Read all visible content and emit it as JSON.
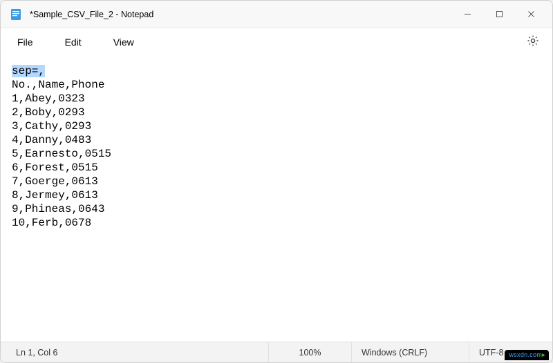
{
  "window": {
    "title": "*Sample_CSV_File_2 - Notepad"
  },
  "menu": {
    "file": "File",
    "edit": "Edit",
    "view": "View"
  },
  "content": {
    "selected": "sep=,",
    "rest": "No.,Name,Phone\n1,Abey,0323\n2,Boby,0293\n3,Cathy,0293\n4,Danny,0483\n5,Earnesto,0515\n6,Forest,0515\n7,Goerge,0613\n8,Jermey,0613\n9,Phineas,0643\n10,Ferb,0678"
  },
  "status": {
    "position": "Ln 1, Col 6",
    "zoom": "100%",
    "line_ending": "Windows (CRLF)",
    "encoding": "UTF-8"
  },
  "watermark": "wsxdn.com"
}
